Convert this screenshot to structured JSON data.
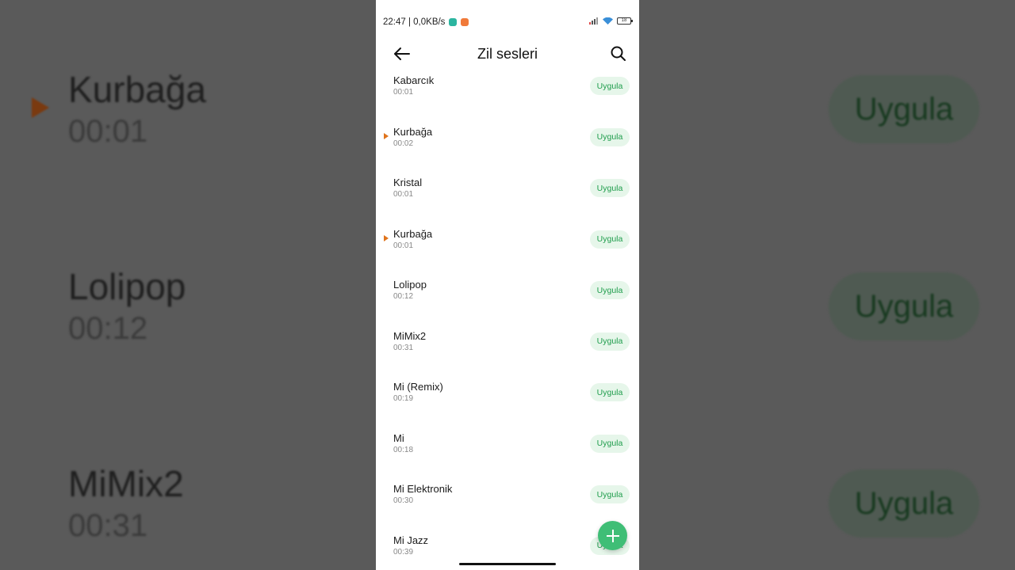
{
  "status_bar": {
    "time_speed": "22:47 | 0,0KB/s",
    "battery_level": "18"
  },
  "header": {
    "title": "Zil sesleri"
  },
  "apply_label": "Uygula",
  "ringtones": [
    {
      "name": "Kabarcık",
      "duration": "00:01",
      "playing": false
    },
    {
      "name": "Kurbağa",
      "duration": "00:02",
      "playing": true
    },
    {
      "name": "Kristal",
      "duration": "00:01",
      "playing": false
    },
    {
      "name": "Kurbağa",
      "duration": "00:01",
      "playing": true
    },
    {
      "name": "Lolipop",
      "duration": "00:12",
      "playing": false
    },
    {
      "name": "MiMix2",
      "duration": "00:31",
      "playing": false
    },
    {
      "name": "Mi (Remix)",
      "duration": "00:19",
      "playing": false
    },
    {
      "name": "Mi",
      "duration": "00:18",
      "playing": false
    },
    {
      "name": "Mi Elektronik",
      "duration": "00:30",
      "playing": false
    },
    {
      "name": "Mi Jazz",
      "duration": "00:39",
      "playing": false
    }
  ],
  "background_zoom": [
    {
      "name": "Kurbağa",
      "duration": "00:01",
      "playing": true
    },
    {
      "name": "Lolipop",
      "duration": "00:12",
      "playing": false
    },
    {
      "name": "MiMix2",
      "duration": "00:31",
      "playing": false
    }
  ],
  "colors": {
    "accent_green": "#3fbe76",
    "apply_text": "#1f9d4c",
    "apply_bg": "#e6f6ea",
    "play_orange": "#e0741c"
  }
}
